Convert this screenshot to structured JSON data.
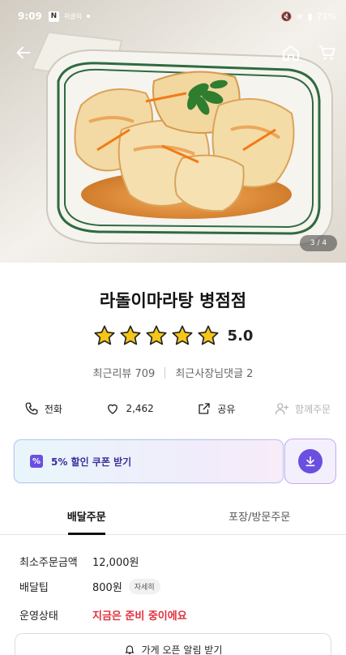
{
  "status_bar": {
    "time": "9:09",
    "n_badge": "N",
    "small_text": "위클릭",
    "right": "71%"
  },
  "hero": {
    "image_counter": "3 / 4",
    "colors": {
      "sauce": "#e08a2c",
      "garnish": "#2f7d2f",
      "plate_rim": "#2e6b3f"
    }
  },
  "nav": {
    "back_icon": "arrow-left-icon",
    "home_icon": "home-icon",
    "cart_icon": "cart-icon"
  },
  "store": {
    "name": "라돌이마라탕 병점점",
    "rating": "5.0",
    "stars": 5,
    "recent_reviews": "최근리뷰 709",
    "owner_comments": "최근사장님댓글 2"
  },
  "actions": [
    {
      "label": "전화",
      "icon": "phone-icon"
    },
    {
      "label": "2,462",
      "icon": "heart-icon"
    },
    {
      "label": "공유",
      "icon": "share-icon"
    },
    {
      "label": "함께주문",
      "icon": "add-person-icon"
    }
  ],
  "coupon": {
    "text": "5% 할인 쿠폰 받기",
    "badge": "%",
    "download_icon": "download-icon"
  },
  "tabs": [
    {
      "label": "배달주문"
    },
    {
      "label": "포장/방문주문"
    }
  ],
  "info": {
    "min_order_label": "최소주문금액",
    "min_order_value": "12,000원",
    "delivery_tip_label": "배달팁",
    "delivery_tip_value": "800원",
    "delivery_tip_detail": "자세히",
    "status_label": "운영상태",
    "status_value": "지금은 준비 중이에요",
    "alarm_button": "가게 오픈 알림 받기"
  },
  "accent_colors": {
    "primary_purple": "#6a4fe0",
    "status_red": "#e0313d",
    "star_yellow": "#f5c518"
  }
}
